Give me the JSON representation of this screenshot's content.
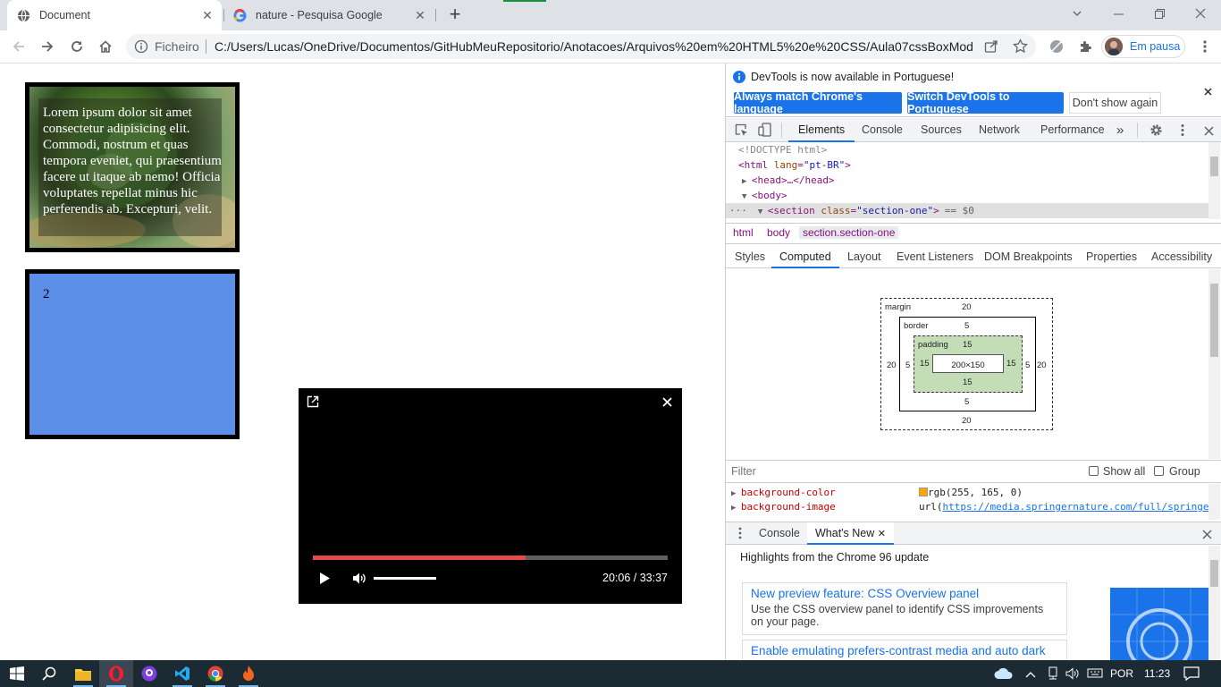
{
  "browser": {
    "tabs": [
      {
        "title": "Document",
        "icon": "globe-icon",
        "active": true
      },
      {
        "title": "nature - Pesquisa Google",
        "icon": "google-icon",
        "active": false
      }
    ],
    "new_tab": "+",
    "address": {
      "scheme": "Ficheiro",
      "url": "C:/Users/Lucas/OneDrive/Documentos/GitHubMeuRepositorio/Anotacoes/Arquivos%20em%20HTML5%20e%20CSS/Aula07cssBoxMod..."
    },
    "profile_label": "Em pausa"
  },
  "page": {
    "box1_text": "Lorem ipsum dolor sit amet consectetur adipisicing elit. Commodi, nostrum et quas tempora eveniet, qui praesentium facere ut itaque ab nemo! Officia voluptates repellat minus hic perferendis ab. Excepturi, velit.",
    "box2_text": "2"
  },
  "video": {
    "time": "20:06 / 33:37",
    "progress": 0.6,
    "volume": 1.0
  },
  "devtools": {
    "infobar_message": "DevTools is now available in Portuguese!",
    "btn_match": "Always match Chrome's language",
    "btn_switch": "Switch DevTools to Portuguese",
    "btn_dont_show": "Don't show again",
    "tabs": [
      "Elements",
      "Console",
      "Sources",
      "Network",
      "Performance"
    ],
    "more_tabs": "»",
    "dom": {
      "doctype": "<!DOCTYPE html>",
      "html_tag": "<html ",
      "html_attr": "lang",
      "html_val": "\"pt-BR\"",
      "html_close": ">",
      "head": "<head>…</head>",
      "body": "<body>",
      "section_open": "<section ",
      "section_attr": "class",
      "section_val": "\"section-one\"",
      "section_close": ">",
      "section_marker": "== $0",
      "ellipsis": "···"
    },
    "breadcrumbs": [
      "html",
      "body",
      "section.section-one"
    ],
    "subtabs": [
      "Styles",
      "Computed",
      "Layout",
      "Event Listeners",
      "DOM Breakpoints",
      "Properties",
      "Accessibility"
    ],
    "box_model": {
      "margin_label": "margin",
      "margin_top": "20",
      "margin_right": "20",
      "margin_bottom": "20",
      "margin_left": "20",
      "border_label": "border",
      "border_top": "5",
      "border_right": "5",
      "border_bottom": "5",
      "border_left": "5",
      "padding_label": "padding",
      "padding_top": "15",
      "padding_right": "15",
      "padding_bottom": "15",
      "padding_left": "15",
      "content": "200×150"
    },
    "filter_placeholder": "Filter",
    "show_all": "Show all",
    "group": "Group",
    "properties": [
      {
        "name": "background-color",
        "value": "rgb(255, 165, 0)",
        "swatch": "#ffa500"
      },
      {
        "name": "background-image",
        "value_prefix": "url(",
        "link": "https://media.springernature.com/full/springe"
      }
    ],
    "drawer_tabs": [
      "Console",
      "What's New"
    ],
    "whatsnew_heading": "Highlights from the Chrome 96 update",
    "cards": [
      {
        "title": "New preview feature: CSS Overview panel",
        "desc": "Use the CSS overview panel to identify CSS improvements on your page."
      },
      {
        "title": "Enable emulating prefers-contrast media and auto dark",
        "desc": ""
      }
    ]
  },
  "taskbar": {
    "lang": "POR",
    "time": "11:23"
  },
  "colors": {
    "accent": "#1a73e8",
    "box2_bg": "#5b8ee6",
    "video_progress": "#e34a4a"
  }
}
